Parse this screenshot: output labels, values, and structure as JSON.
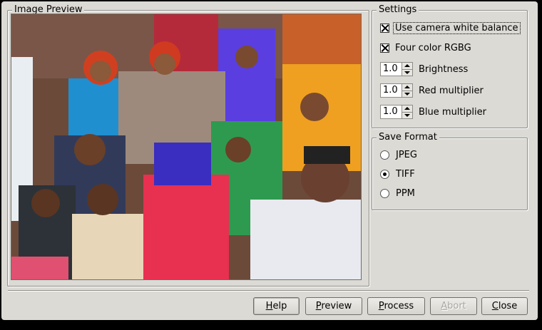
{
  "preview": {
    "label": "Image Preview"
  },
  "settings": {
    "label": "Settings",
    "camera_wb_label": "Use camera white balance",
    "four_color_label": "Four color RGBG",
    "brightness": {
      "value": "1.0",
      "label": "Brightness"
    },
    "red_multiplier": {
      "value": "1.0",
      "label": "Red multiplier"
    },
    "blue_multiplier": {
      "value": "1.0",
      "label": "Blue multiplier"
    }
  },
  "save_format": {
    "label": "Save Format",
    "options": [
      "JPEG",
      "TIFF",
      "PPM"
    ],
    "selected": "TIFF"
  },
  "buttons": {
    "help": {
      "first": "H",
      "rest": "elp"
    },
    "preview": {
      "first": "P",
      "rest": "review"
    },
    "process": {
      "first": "P",
      "rest": "rocess"
    },
    "abort": {
      "first": "A",
      "rest": "bort"
    },
    "close": {
      "first": "C",
      "rest": "lose"
    }
  },
  "icons": [
    "checkbox-checked-icon",
    "spin-up-icon",
    "spin-down-icon",
    "radio-icon"
  ],
  "colors": {
    "window_bg": "#dcdad5",
    "frame_border": "#8e8c86"
  }
}
